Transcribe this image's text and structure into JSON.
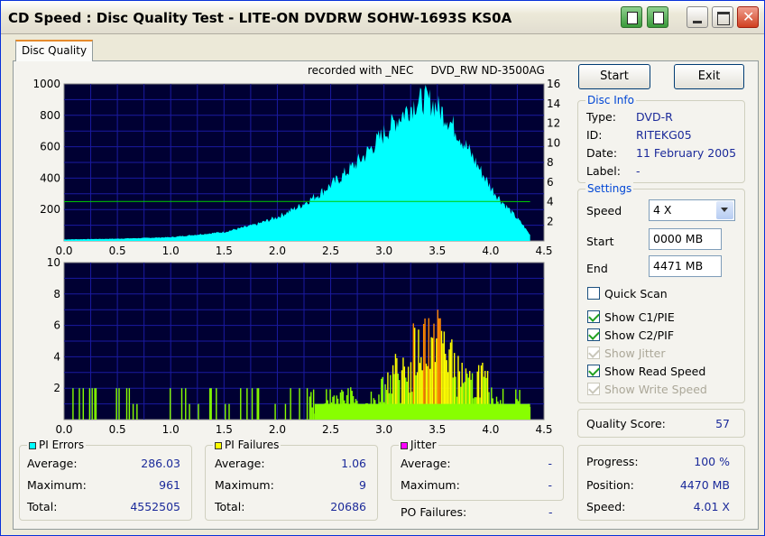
{
  "window": {
    "title": "CD Speed : Disc Quality Test - LITE-ON DVDRW SOHW-1693S KS0A"
  },
  "tabs": [
    {
      "label": "Disc Quality"
    }
  ],
  "chart_header": "recorded with _NEC     DVD_RW ND-3500AG",
  "chart_data": [
    {
      "type": "area",
      "series": [
        {
          "name": "PI Errors",
          "color": "#00ffff",
          "x": [
            0.0,
            0.5,
            1.0,
            1.5,
            1.8,
            2.0,
            2.2,
            2.4,
            2.6,
            2.8,
            3.0,
            3.1,
            3.2,
            3.3,
            3.4,
            3.5,
            3.6,
            3.7,
            3.8,
            3.9,
            4.0,
            4.1,
            4.2,
            4.3,
            4.37
          ],
          "values": [
            10,
            15,
            25,
            60,
            110,
            160,
            230,
            320,
            430,
            560,
            720,
            800,
            870,
            930,
            950,
            900,
            820,
            720,
            600,
            480,
            360,
            270,
            190,
            110,
            40
          ]
        },
        {
          "name": "Read Speed",
          "color": "#00cc00",
          "axis": "right",
          "x": [
            0.0,
            0.5,
            1.0,
            2.0,
            3.0,
            4.0,
            4.37
          ],
          "values": [
            4.0,
            4.02,
            4.02,
            4.02,
            4.02,
            4.02,
            4.0
          ]
        }
      ],
      "xlim": [
        0,
        4.5
      ],
      "ylim": [
        0,
        1000
      ],
      "y2lim": [
        0,
        16
      ],
      "xticks": [
        "0.0",
        "0.5",
        "1.0",
        "1.5",
        "2.0",
        "2.5",
        "3.0",
        "3.5",
        "4.0",
        "4.5"
      ],
      "yticks": [
        "200",
        "400",
        "600",
        "800",
        "1000"
      ],
      "y2ticks": [
        "2",
        "4",
        "6",
        "8",
        "10",
        "12",
        "14",
        "16"
      ],
      "grid": true
    },
    {
      "type": "bar",
      "series": [
        {
          "name": "PI Failures",
          "color": "#ffff00",
          "x": [
            0.2,
            0.45,
            0.5,
            0.75,
            0.9,
            1.1,
            1.25,
            1.4,
            1.55,
            1.7,
            1.85,
            2.0,
            2.2,
            2.3,
            2.4,
            2.5,
            2.6,
            2.7,
            2.8,
            2.9,
            3.0,
            3.05,
            3.1,
            3.15,
            3.2,
            3.25,
            3.3,
            3.35,
            3.4,
            3.45,
            3.5,
            3.55,
            3.6,
            3.65,
            3.7,
            3.75,
            3.8,
            3.85,
            3.9,
            3.95,
            4.0,
            4.05,
            4.1,
            4.15,
            4.2,
            4.25,
            4.3,
            4.35
          ],
          "values": [
            2,
            1,
            2,
            1,
            2,
            2,
            1,
            2,
            1,
            2,
            2,
            1,
            2,
            2,
            1,
            2,
            2,
            2,
            1,
            2,
            3,
            4,
            4,
            3,
            5,
            4,
            6,
            7,
            8,
            6,
            9,
            7,
            6,
            5,
            4,
            4,
            3,
            3,
            4,
            3,
            2,
            2,
            2,
            1,
            1,
            2,
            1,
            1
          ]
        }
      ],
      "xlim": [
        0,
        4.5
      ],
      "ylim": [
        0,
        10
      ],
      "xticks": [
        "0.0",
        "0.5",
        "1.0",
        "1.5",
        "2.0",
        "2.5",
        "3.0",
        "3.5",
        "4.0",
        "4.5"
      ],
      "yticks": [
        "2",
        "4",
        "6",
        "8",
        "10"
      ],
      "grid": true
    }
  ],
  "stats": {
    "pi_errors": {
      "title": "PI Errors",
      "color": "#00ffff",
      "average_label": "Average:",
      "average": "286.03",
      "maximum_label": "Maximum:",
      "maximum": "961",
      "total_label": "Total:",
      "total": "4552505"
    },
    "pi_failures": {
      "title": "PI Failures",
      "color": "#ffff00",
      "average_label": "Average:",
      "average": "1.06",
      "maximum_label": "Maximum:",
      "maximum": "9",
      "total_label": "Total:",
      "total": "20686"
    },
    "jitter": {
      "title": "Jitter",
      "color": "#ff00ff",
      "average_label": "Average:",
      "average": "-",
      "maximum_label": "Maximum:",
      "maximum": "-"
    },
    "po_failures_label": "PO Failures:",
    "po_failures": "-"
  },
  "buttons": {
    "start": "Start",
    "exit": "Exit"
  },
  "disc_info": {
    "title": "Disc Info",
    "type_label": "Type:",
    "type": "DVD-R",
    "id_label": "ID:",
    "id": "RITEKG05",
    "date_label": "Date:",
    "date": "11 February 2005",
    "label_label": "Label:",
    "label": "-"
  },
  "settings": {
    "title": "Settings",
    "speed_label": "Speed",
    "speed": "4 X",
    "start_label": "Start",
    "start": "0000 MB",
    "end_label": "End",
    "end": "4471 MB",
    "quick_scan": "Quick Scan",
    "show_c1": "Show C1/PIE",
    "show_c2": "Show C2/PIF",
    "show_jitter": "Show Jitter",
    "show_read": "Show Read Speed",
    "show_write": "Show Write Speed"
  },
  "quality": {
    "label": "Quality Score:",
    "value": "57"
  },
  "progress": {
    "progress_label": "Progress:",
    "progress": "100 %",
    "position_label": "Position:",
    "position": "4470 MB",
    "speed_label": "Speed:",
    "speed": "4.01 X"
  }
}
